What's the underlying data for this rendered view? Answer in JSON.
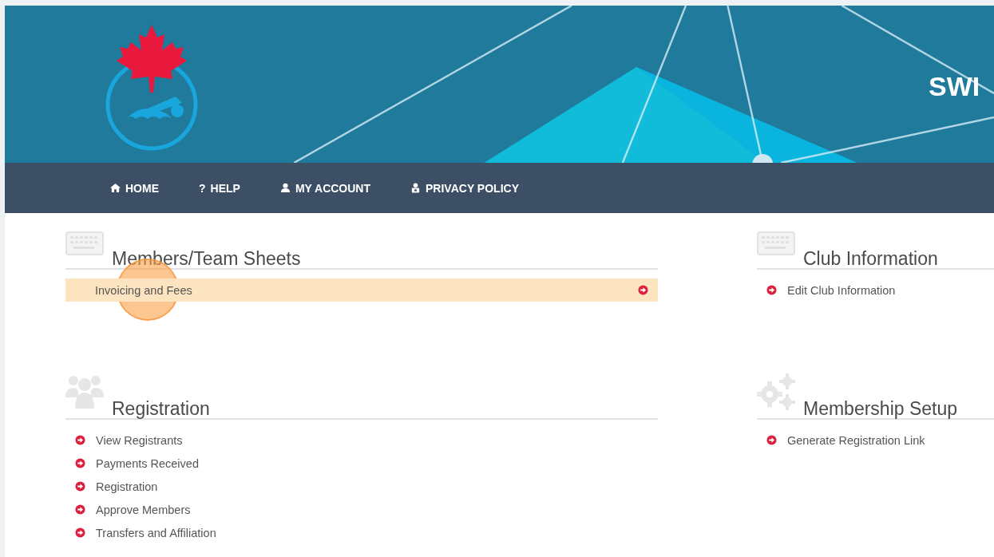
{
  "header": {
    "title": "SWI"
  },
  "nav": [
    {
      "label": "HOME"
    },
    {
      "label": "HELP",
      "glyph": "?"
    },
    {
      "label": "MY ACCOUNT"
    },
    {
      "label": "PRIVACY POLICY"
    }
  ],
  "columns": [
    {
      "sections": [
        {
          "title": "Members/Team Sheets",
          "kind": "bar",
          "items": [
            {
              "label": "Invoicing and Fees",
              "selected": true
            }
          ]
        },
        {
          "title": "Registration",
          "kind": "list",
          "items": [
            {
              "label": "View Registrants",
              "selected": false
            },
            {
              "label": "Payments Received",
              "selected": false
            },
            {
              "label": "Registration",
              "selected": false
            },
            {
              "label": "Approve Members",
              "selected": false
            },
            {
              "label": "Transfers and Affiliation",
              "selected": false
            }
          ]
        }
      ]
    },
    {
      "sections": [
        {
          "title": "Club Information",
          "kind": "list",
          "items": [
            {
              "label": "Edit Club Information",
              "selected": false
            }
          ]
        },
        {
          "title": "Membership Setup",
          "kind": "list",
          "items": [
            {
              "label": "Generate Registration Link",
              "selected": false
            }
          ]
        }
      ]
    }
  ]
}
